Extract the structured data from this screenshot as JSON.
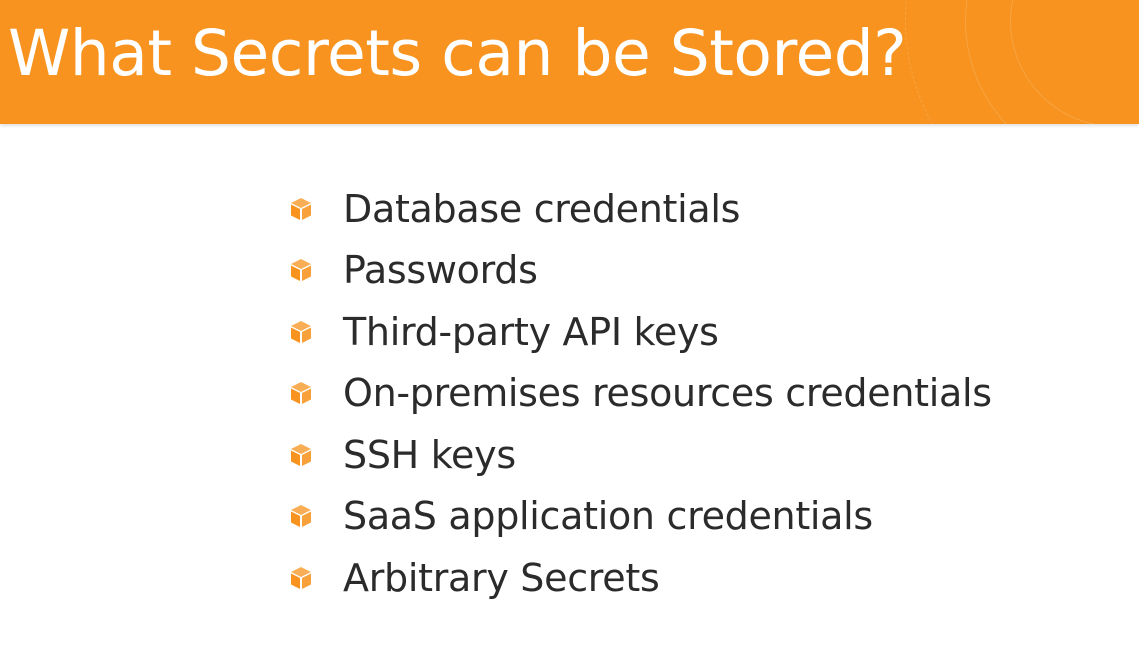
{
  "slide": {
    "title": "What Secrets can be Stored?",
    "accent_color": "#f7931e",
    "bullet_icon": "aws-cube-icon",
    "bullets": [
      "Database credentials",
      "Passwords",
      "Third-party API keys",
      "On-premises resources credentials",
      "SSH keys",
      "SaaS application credentials",
      "Arbitrary Secrets"
    ]
  }
}
